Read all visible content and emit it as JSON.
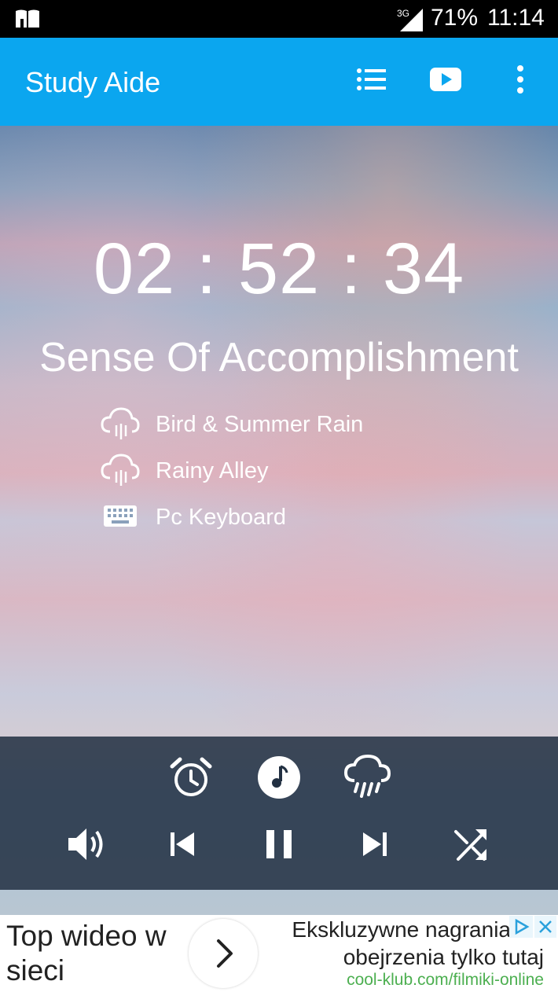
{
  "status_bar": {
    "network": "3G",
    "battery": "71%",
    "time": "11:14"
  },
  "app_bar": {
    "title": "Study Aide",
    "icons": [
      "list-icon",
      "play-video-icon",
      "more-vert-icon"
    ]
  },
  "timer": {
    "display": "02 : 52 : 34"
  },
  "session_name": "Sense Of Accomplishment",
  "sounds": [
    {
      "label": "Bird & Summer Rain",
      "icon": "cloud-rain-icon"
    },
    {
      "label": "Rainy Alley",
      "icon": "cloud-rain-icon"
    },
    {
      "label": "Pc Keyboard",
      "icon": "keyboard-icon"
    }
  ],
  "controls": {
    "top_row": [
      "alarm-clock-icon",
      "music-note-icon",
      "rain-cloud-icon"
    ],
    "bottom_row": [
      "volume-icon",
      "previous-icon",
      "pause-icon",
      "next-icon",
      "shuffle-icon"
    ]
  },
  "ad": {
    "headline": "Top wideo w sieci",
    "line1": "Ekskluzywne nagrania",
    "line2": "obejrzenia tylko tutaj",
    "url": "cool-klub.com/filmiki-online"
  },
  "colors": {
    "app_bar": "#0ba6ef",
    "panel": "#223042",
    "ad_url": "#4caf50"
  }
}
